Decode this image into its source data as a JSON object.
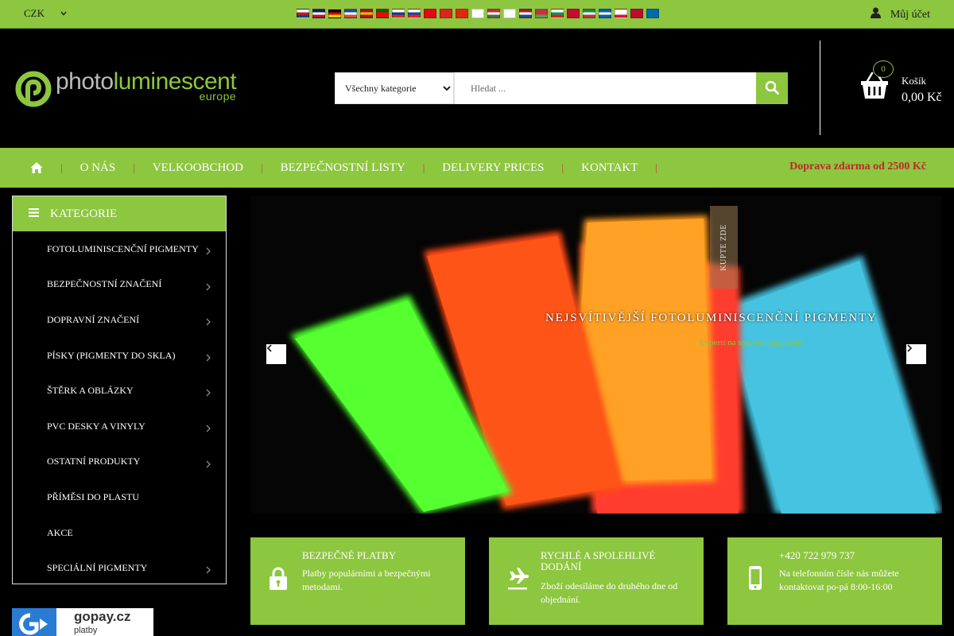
{
  "topbar": {
    "currency": "CZK",
    "languages": [
      {
        "code": "cs",
        "colors": [
          "#ffffff",
          "#d7141a",
          "#11457e"
        ]
      },
      {
        "code": "en",
        "colors": [
          "#012169",
          "#ffffff",
          "#c8102e"
        ]
      },
      {
        "code": "de",
        "colors": [
          "#000000",
          "#dd0000",
          "#ffce00"
        ]
      },
      {
        "code": "fr",
        "colors": [
          "#0055a4",
          "#ffffff",
          "#ef4135"
        ]
      },
      {
        "code": "es",
        "colors": [
          "#aa151b",
          "#f1bf00",
          "#aa151b"
        ]
      },
      {
        "code": "pt",
        "colors": [
          "#006600",
          "#ff0000",
          "#ff0000"
        ]
      },
      {
        "code": "ru",
        "colors": [
          "#ffffff",
          "#0039a6",
          "#d52b1e"
        ]
      },
      {
        "code": "sk",
        "colors": [
          "#ffffff",
          "#0b4ea2",
          "#ee1c25"
        ]
      },
      {
        "code": "tr",
        "colors": [
          "#e30a17",
          "#e30a17",
          "#e30a17"
        ]
      },
      {
        "code": "vi",
        "colors": [
          "#da251d",
          "#da251d",
          "#da251d"
        ]
      },
      {
        "code": "zh",
        "colors": [
          "#de2910",
          "#de2910",
          "#de2910"
        ]
      },
      {
        "code": "ja",
        "colors": [
          "#ffffff",
          "#ffffff",
          "#ffffff"
        ]
      },
      {
        "code": "hu",
        "colors": [
          "#cd2a3e",
          "#ffffff",
          "#436f4d"
        ]
      },
      {
        "code": "fi",
        "colors": [
          "#ffffff",
          "#ffffff",
          "#ffffff"
        ]
      },
      {
        "code": "nl",
        "colors": [
          "#ae1c28",
          "#ffffff",
          "#21468b"
        ]
      },
      {
        "code": "be",
        "colors": [
          "#c8313e",
          "#c8313e",
          "#4aa657"
        ]
      },
      {
        "code": "bg",
        "colors": [
          "#ffffff",
          "#00966e",
          "#d62612"
        ]
      },
      {
        "code": "da",
        "colors": [
          "#c60c30",
          "#c60c30",
          "#c60c30"
        ]
      },
      {
        "code": "it",
        "colors": [
          "#009246",
          "#ffffff",
          "#ce2b37"
        ]
      },
      {
        "code": "el",
        "colors": [
          "#0d5eaf",
          "#ffffff",
          "#0d5eaf"
        ]
      },
      {
        "code": "pl",
        "colors": [
          "#ffffff",
          "#ffffff",
          "#dc143c"
        ]
      },
      {
        "code": "no",
        "colors": [
          "#ba0c2f",
          "#ba0c2f",
          "#ba0c2f"
        ]
      },
      {
        "code": "sv",
        "colors": [
          "#006aa7",
          "#006aa7",
          "#006aa7"
        ]
      }
    ],
    "account_label": "Můj účet",
    "account_icon": "user-icon"
  },
  "header": {
    "logo_text_photo": "photo",
    "logo_text_luminescent": "luminescent",
    "logo_sub": "europe",
    "search_category": "Všechny kategorie",
    "search_placeholder": "Hledat ...",
    "search_icon": "search-icon",
    "cart_count": "0",
    "cart_label": "Košík",
    "cart_total": "0,00 Kč"
  },
  "nav": {
    "home_icon": "home-icon",
    "items": [
      "O NÁS",
      "VELKOOBCHOD",
      "BEZPEČNOSTNÍ LISTY",
      "DELIVERY PRICES",
      "KONTAKT"
    ],
    "promo": "Doprava zdarma od 2500 Kč"
  },
  "categories": {
    "title": "KATEGORIE",
    "icon": "menu-icon",
    "items": [
      {
        "label": "FOTOLUMINISCENČNÍ PIGMENTY",
        "has_sub": true
      },
      {
        "label": "BEZPEČNOSTNÍ ZNAČENÍ",
        "has_sub": true
      },
      {
        "label": "DOPRAVNÍ ZNAČENÍ",
        "has_sub": true
      },
      {
        "label": "PÍSKY (PIGMENTY DO SKLA)",
        "has_sub": true
      },
      {
        "label": "ŠTĚRK A OBLÁZKY",
        "has_sub": true
      },
      {
        "label": "PVC DESKY A VINYLY",
        "has_sub": true
      },
      {
        "label": "OSTATNÍ PRODUKTY",
        "has_sub": true
      },
      {
        "label": "PŘÍMĚSI DO PLASTU",
        "has_sub": false
      },
      {
        "label": "AKCE",
        "has_sub": false
      },
      {
        "label": "SPECIÁLNÍ PIGMENTY",
        "has_sub": true
      }
    ]
  },
  "gopay": {
    "brand": "gopay.cz",
    "sub": "platby"
  },
  "slider": {
    "title": "NEJSVÍTIVĚJŠÍ FOTOLUMINISCENČNÍ PIGMENTY",
    "subtitle": "Experti na speciální pigmenty",
    "cta": "KUPTE ZDE"
  },
  "features": [
    {
      "icon": "lock-icon",
      "title": "BEZPEČNÉ PLATBY",
      "desc": "Platby populárními a bezpečnými metodami."
    },
    {
      "icon": "plane-icon",
      "title": "RYCHLÉ A SPOLEHLIVÉ DODÁNÍ",
      "desc": "Zboží odesíláme do druhého dne od objednání."
    },
    {
      "icon": "phone-icon",
      "title": "+420 722 979 737",
      "desc": "Na telefonním čísle nás můžete kontaktovat po-pá 8:00-16:00"
    }
  ],
  "colors": {
    "brand_green": "#8dc63f",
    "promo_red": "#c0272d"
  }
}
